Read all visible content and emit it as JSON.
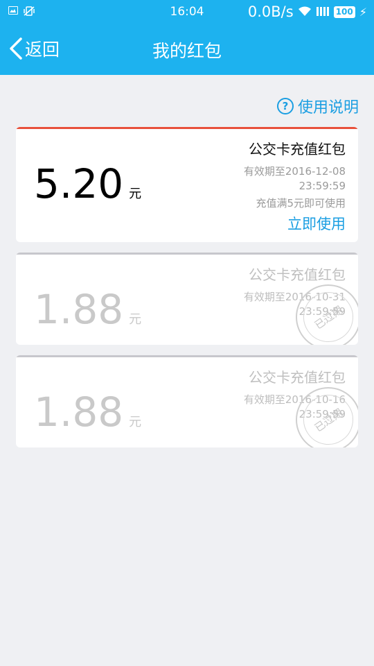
{
  "status_bar": {
    "time": "16:04",
    "network_speed": "0.0B/s",
    "battery": "100"
  },
  "nav": {
    "back_label": "返回",
    "title": "我的红包"
  },
  "help": {
    "label": "使用说明"
  },
  "cards": [
    {
      "amount": "5.20",
      "unit": "元",
      "title": "公交卡充值红包",
      "expiry_line1": "有效期至2016-12-08",
      "expiry_line2": "23:59:59",
      "condition": "充值满5元即可使用",
      "action": "立即使用",
      "status": "active"
    },
    {
      "amount": "1.88",
      "unit": "元",
      "title": "公交卡充值红包",
      "expiry_line1": "有效期至2016-10-31",
      "expiry_line2": "23:59:59",
      "stamp": "已过期",
      "status": "expired"
    },
    {
      "amount": "1.88",
      "unit": "元",
      "title": "公交卡充值红包",
      "expiry_line1": "有效期至2016-10-16",
      "expiry_line2": "23:59:59",
      "stamp": "已过期",
      "status": "expired"
    }
  ],
  "colors": {
    "header": "#1db2ef",
    "accent": "#1a9ee2",
    "active_strip": "#e8503a",
    "expired_strip": "#c7c7cc"
  }
}
